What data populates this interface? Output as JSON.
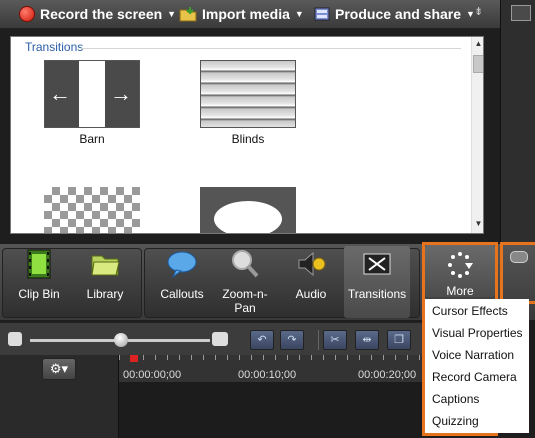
{
  "toolbar": {
    "record_label": "Record the screen",
    "import_label": "Import media",
    "produce_label": "Produce and share",
    "overflow_glyph": "⇟"
  },
  "panel": {
    "title": "Transitions",
    "items": [
      {
        "label": "Barn"
      },
      {
        "label": "Blinds"
      },
      {
        "label": ""
      },
      {
        "label": ""
      }
    ]
  },
  "tabs": [
    {
      "label": "Clip Bin",
      "icon": "film-icon"
    },
    {
      "label": "Library",
      "icon": "folder-icon"
    },
    {
      "label": "Callouts",
      "icon": "speech-bubble-icon"
    },
    {
      "label": "Zoom-n-\nPan",
      "icon": "magnifier-icon"
    },
    {
      "label": "Audio",
      "icon": "speaker-icon"
    },
    {
      "label": "Transitions",
      "icon": "transitions-icon"
    },
    {
      "label": "More",
      "icon": "more-dots-icon"
    }
  ],
  "more_menu": [
    "Cursor Effects",
    "Visual Properties",
    "Voice Narration",
    "Record Camera",
    "Captions",
    "Quizzing"
  ],
  "timeline": {
    "ruler_labels": [
      "00:00:00;00",
      "00:00:10;00",
      "00:00:20;00"
    ]
  },
  "colors": {
    "highlight": "#e8731d",
    "panel_title": "#2a5ea8"
  }
}
